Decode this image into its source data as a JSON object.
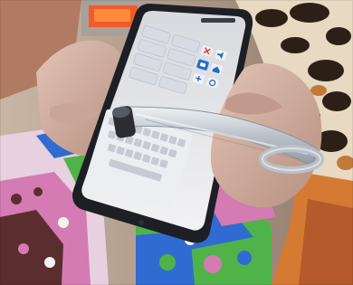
{
  "scene": {
    "subject": "hand-held-smartphone-with-foil-stylus",
    "colors": {
      "background_warm": "#c9b7a5",
      "phone_body": "#1d1f25",
      "screen": "#e5e6ea",
      "foil": "#c9ced4",
      "leopard_fabric": "#e7d9c2",
      "leopard_spot": "#2c2016",
      "knit_green": "#4fb34a",
      "knit_blue": "#2f6bd1",
      "knit_pink": "#d37bb2",
      "knit_maroon": "#5a2d2f",
      "skin": "#d2b0a0"
    },
    "icons": [
      "close-icon",
      "volume-icon",
      "camera-icon",
      "home-icon",
      "plus-icon",
      "settings-icon"
    ]
  }
}
